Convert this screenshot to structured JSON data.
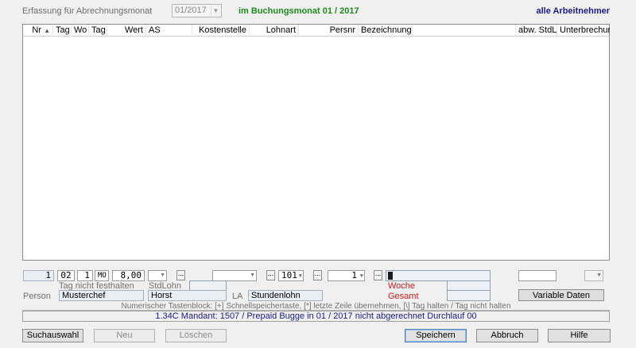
{
  "top": {
    "month_label": "Erfassung für Abrechnungsmonat",
    "month_value": "01/2017",
    "booking_month": "im Buchungsmonat 01 / 2017",
    "employees": "alle Arbeitnehmer"
  },
  "grid": {
    "columns": [
      "Nr",
      "Tag",
      "Wo",
      "Tag",
      "Wert",
      "AS",
      "Kostenstelle",
      "Lohnart",
      "Persnr",
      "Bezeichnung",
      "abw. StdLohn",
      "Unterbrechung"
    ],
    "sort_indicator": "▲"
  },
  "entry": {
    "nr": "1",
    "day": "02",
    "week": "1",
    "weekday": "MO",
    "value": "8,00",
    "lohnart": "101",
    "persnr": "1",
    "dots": "..."
  },
  "labels": {
    "day_not_held": "Tag nicht festhalten",
    "std_lohn": "StdLohn",
    "person": "Person",
    "person_value": "Musterchef",
    "person_first": "Horst",
    "la": "LA",
    "la_value": "Stundenlohn",
    "woche": "Woche",
    "gesamt": "Gesamt",
    "variable_data": "Variable Daten",
    "hint": "Numerischer Tastenblock:  [+] Schnellspeichertaste, [*] letzte Zeile übernehmen, [\\] Tag halten / Tag nicht halten"
  },
  "status": "1.34C Mandant: 1507 / Prepaid Bugge in 01 / 2017 nicht abgerechnet   Durchlauf 00",
  "buttons": {
    "search": "Suchauswahl",
    "new": "Neu",
    "delete": "Löschen",
    "save": "Speichern",
    "cancel": "Abbruch",
    "help": "Hilfe"
  },
  "colors": {
    "accent_green": "#1f8a1f",
    "accent_navy": "#1a1a8c",
    "alert_red": "#cc1a1a"
  }
}
